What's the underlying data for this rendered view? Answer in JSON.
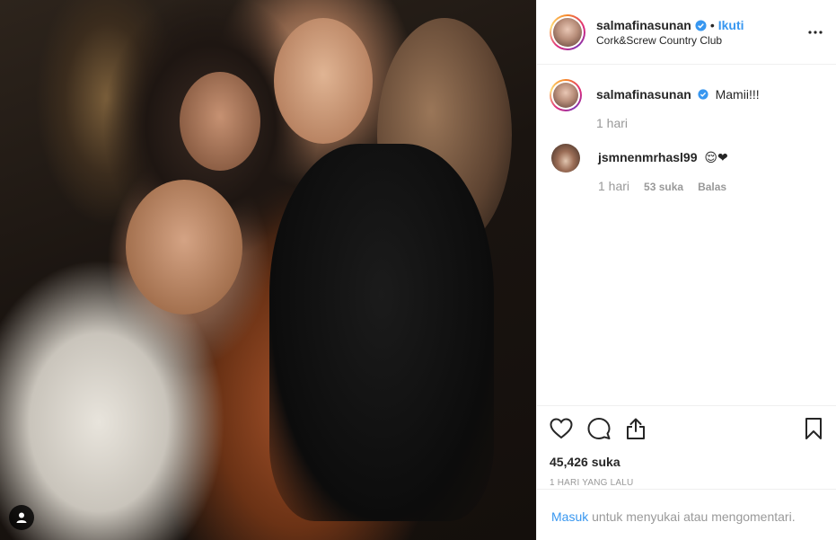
{
  "post": {
    "username": "salmafinasunan",
    "dot": "•",
    "follow_label": "Ikuti",
    "location": "Cork&Screw Country Club",
    "more_icon": "more-horizontal-icon"
  },
  "comments": [
    {
      "username": "salmafinasunan",
      "text": "Mamii!!!",
      "time": "1 hari"
    },
    {
      "username": "jsmnenmrhasl99",
      "text": "😌❤",
      "time": "1 hari",
      "likes": "53 suka",
      "reply_label": "Balas"
    }
  ],
  "actions": {
    "like_icon": "heart-icon",
    "comment_icon": "comment-icon",
    "share_icon": "share-icon",
    "save_icon": "bookmark-icon",
    "likes_count": "45,426 suka",
    "time_ago": "1 HARI YANG LALU"
  },
  "login_bar": {
    "link": "Masuk",
    "text": " untuk menyukai atau mengomentari."
  },
  "colors": {
    "link": "#3897f0",
    "muted": "#999999",
    "text": "#262626",
    "border": "#efefef"
  }
}
